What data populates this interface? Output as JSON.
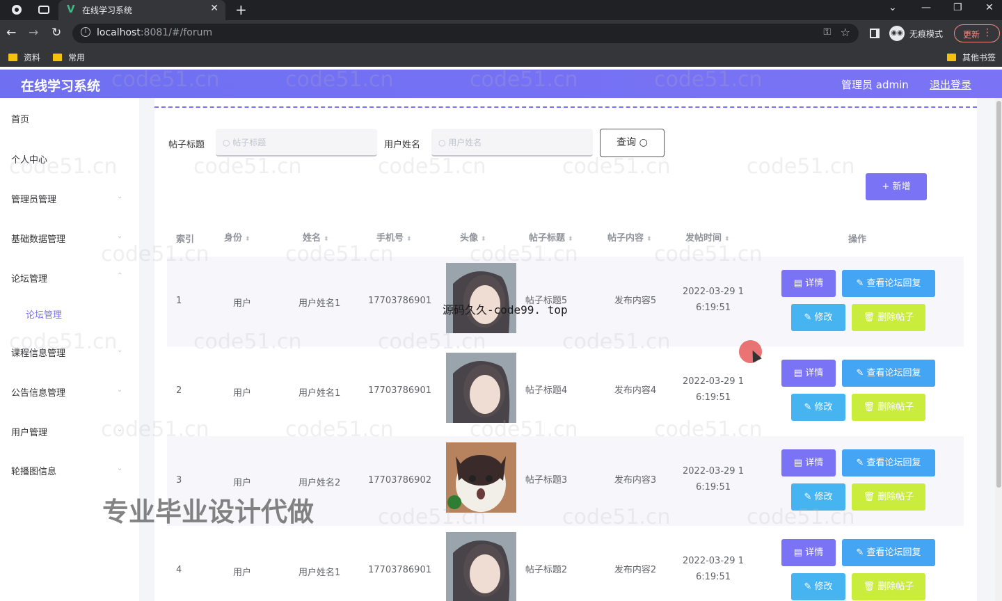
{
  "browser": {
    "tab_title": "在线学习系统",
    "url_host": "localhost",
    "url_rest": ":8081/#/forum",
    "incognito_label": "无痕模式",
    "update_label": "更新",
    "bookmarks": [
      "资料",
      "常用"
    ],
    "other_bookmarks": "其他书签"
  },
  "header": {
    "brand": "在线学习系统",
    "admin_label": "管理员 admin",
    "logout_label": "退出登录"
  },
  "sidebar": {
    "items": [
      {
        "label": "首页"
      },
      {
        "label": "个人中心"
      },
      {
        "label": "管理员管理"
      },
      {
        "label": "基础数据管理"
      },
      {
        "label": "论坛管理"
      },
      {
        "label": "论坛管理"
      },
      {
        "label": "课程信息管理"
      },
      {
        "label": "公告信息管理"
      },
      {
        "label": "用户管理"
      },
      {
        "label": "轮播图信息"
      }
    ]
  },
  "search": {
    "title_label": "帖子标题",
    "title_placeholder": "帖子标题",
    "name_label": "用户姓名",
    "name_placeholder": "用户姓名",
    "query_label": "查询",
    "add_label": "新增"
  },
  "table": {
    "headers": [
      "索引",
      "身份",
      "姓名",
      "手机号",
      "头像",
      "帖子标题",
      "帖子内容",
      "发帖时间",
      "操作"
    ],
    "rows": [
      {
        "index": "1",
        "role": "用户",
        "name": "用户姓名1",
        "phone": "17703786901",
        "title": "帖子标题5",
        "content": "发布内容5",
        "time1": "2022-03-29 1",
        "time2": "6:19:51"
      },
      {
        "index": "2",
        "role": "用户",
        "name": "用户姓名1",
        "phone": "17703786901",
        "title": "帖子标题4",
        "content": "发布内容4",
        "time1": "2022-03-29 1",
        "time2": "6:19:51"
      },
      {
        "index": "3",
        "role": "用户",
        "name": "用户姓名2",
        "phone": "17703786902",
        "title": "帖子标题3",
        "content": "发布内容3",
        "time1": "2022-03-29 1",
        "time2": "6:19:51"
      },
      {
        "index": "4",
        "role": "用户",
        "name": "用户姓名1",
        "phone": "17703786901",
        "title": "帖子标题2",
        "content": "发布内容2",
        "time1": "2022-03-29 1",
        "time2": "6:19:51"
      }
    ],
    "actions": {
      "detail": "详情",
      "reply": "查看论坛回复",
      "edit": "修改",
      "delete": "删除帖子"
    }
  },
  "overlays": {
    "watermark": "code51.cn",
    "promo": "专业毕业设计代做",
    "source": "源码久久-code99. top"
  }
}
